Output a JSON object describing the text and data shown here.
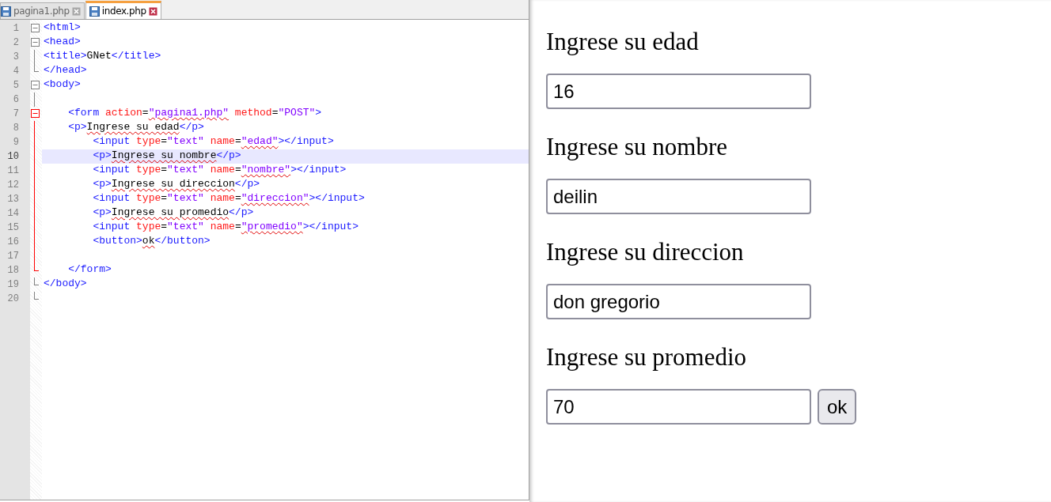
{
  "editor": {
    "tabs": [
      {
        "label": "pagina1.php",
        "selected": false
      },
      {
        "label": "index.php",
        "selected": true
      }
    ],
    "lines": [
      {
        "number": "1",
        "kind": "start",
        "color": "#808080",
        "current": false,
        "tokens": [
          {
            "t": "<html>",
            "kind": "tag"
          }
        ]
      },
      {
        "number": "2",
        "kind": "start",
        "color": "#808080",
        "current": false,
        "tokens": [
          {
            "t": "<head>",
            "kind": "tag"
          }
        ]
      },
      {
        "number": "3",
        "kind": "body",
        "color": "#808080",
        "current": false,
        "tokens": [
          {
            "t": "<title>",
            "kind": "tag"
          },
          {
            "t": "GNet",
            "kind": "text"
          },
          {
            "t": "</title>",
            "kind": "tag"
          }
        ]
      },
      {
        "number": "4",
        "kind": "end",
        "color": "#808080",
        "current": false,
        "tokens": [
          {
            "t": "</head>",
            "kind": "tag"
          }
        ]
      },
      {
        "number": "5",
        "kind": "start",
        "color": "#808080",
        "current": false,
        "tokens": [
          {
            "t": "<body>",
            "kind": "tag"
          }
        ]
      },
      {
        "number": "6",
        "kind": "body",
        "color": "#808080",
        "current": false
      },
      {
        "number": "7",
        "kind": "start",
        "color": "#ff0000",
        "current": false,
        "tokens": [
          {
            "t": "    <form ",
            "kind": "tag"
          },
          {
            "t": "action",
            "kind": "attr"
          },
          {
            "t": "=",
            "kind": "text"
          },
          {
            "t": "\"pagina1.php\"",
            "kind": "value",
            "flagged": true
          },
          {
            "t": " method",
            "kind": "attr"
          },
          {
            "t": "=",
            "kind": "text"
          },
          {
            "t": "\"POST\"",
            "kind": "value"
          },
          {
            "t": ">",
            "kind": "tag"
          }
        ]
      },
      {
        "number": "8",
        "kind": "body",
        "color": "#ff0000",
        "current": false,
        "tokens": [
          {
            "t": "    <p>",
            "kind": "tag"
          },
          {
            "t": "Ingrese su edad",
            "kind": "text",
            "flagged": true
          },
          {
            "t": "</p>",
            "kind": "tag"
          }
        ]
      },
      {
        "number": "9",
        "kind": "body",
        "color": "#ff0000",
        "current": false,
        "tokens": [
          {
            "t": "        <input ",
            "kind": "tag"
          },
          {
            "t": "type",
            "kind": "attr"
          },
          {
            "t": "=",
            "kind": "text"
          },
          {
            "t": "\"text\"",
            "kind": "value"
          },
          {
            "t": " name",
            "kind": "attr"
          },
          {
            "t": "=",
            "kind": "text"
          },
          {
            "t": "\"edad\"",
            "kind": "value",
            "flagged": true
          },
          {
            "t": "></input>",
            "kind": "tag"
          }
        ]
      },
      {
        "number": "10",
        "kind": "body",
        "color": "#ff0000",
        "current": true,
        "tokens": [
          {
            "t": "        <p>",
            "kind": "tag"
          },
          {
            "t": "Ingrese su nombre",
            "kind": "text",
            "flagged": true
          },
          {
            "t": "</p>",
            "kind": "tag"
          }
        ]
      },
      {
        "number": "11",
        "kind": "body",
        "color": "#ff0000",
        "current": false,
        "tokens": [
          {
            "t": "        <input ",
            "kind": "tag"
          },
          {
            "t": "type",
            "kind": "attr"
          },
          {
            "t": "=",
            "kind": "text"
          },
          {
            "t": "\"text\"",
            "kind": "value"
          },
          {
            "t": " name",
            "kind": "attr"
          },
          {
            "t": "=",
            "kind": "text"
          },
          {
            "t": "\"nombre\"",
            "kind": "value",
            "flagged": true
          },
          {
            "t": "></input>",
            "kind": "tag"
          }
        ]
      },
      {
        "number": "12",
        "kind": "body",
        "color": "#ff0000",
        "current": false,
        "tokens": [
          {
            "t": "        <p>",
            "kind": "tag"
          },
          {
            "t": "Ingrese su direccion",
            "kind": "text",
            "flagged": true
          },
          {
            "t": "</p>",
            "kind": "tag"
          }
        ]
      },
      {
        "number": "13",
        "kind": "body",
        "color": "#ff0000",
        "current": false,
        "tokens": [
          {
            "t": "        <input ",
            "kind": "tag"
          },
          {
            "t": "type",
            "kind": "attr"
          },
          {
            "t": "=",
            "kind": "text"
          },
          {
            "t": "\"text\"",
            "kind": "value"
          },
          {
            "t": " name",
            "kind": "attr"
          },
          {
            "t": "=",
            "kind": "text"
          },
          {
            "t": "\"direccion\"",
            "kind": "value",
            "flagged": true
          },
          {
            "t": "></input>",
            "kind": "tag"
          }
        ]
      },
      {
        "number": "14",
        "kind": "body",
        "color": "#ff0000",
        "current": false,
        "tokens": [
          {
            "t": "        <p>",
            "kind": "tag"
          },
          {
            "t": "Ingrese su promedio",
            "kind": "text",
            "flagged": true
          },
          {
            "t": "</p>",
            "kind": "tag"
          }
        ]
      },
      {
        "number": "15",
        "kind": "body",
        "color": "#ff0000",
        "current": false,
        "tokens": [
          {
            "t": "        <input ",
            "kind": "tag"
          },
          {
            "t": "type",
            "kind": "attr"
          },
          {
            "t": "=",
            "kind": "text"
          },
          {
            "t": "\"text\"",
            "kind": "value"
          },
          {
            "t": " name",
            "kind": "attr"
          },
          {
            "t": "=",
            "kind": "text"
          },
          {
            "t": "\"promedio\"",
            "kind": "value",
            "flagged": true
          },
          {
            "t": "></input>",
            "kind": "tag"
          }
        ]
      },
      {
        "number": "16",
        "kind": "body",
        "color": "#ff0000",
        "current": false,
        "tokens": [
          {
            "t": "        <button>",
            "kind": "tag"
          },
          {
            "t": "ok",
            "kind": "text",
            "flagged": true
          },
          {
            "t": "</button>",
            "kind": "tag"
          }
        ]
      },
      {
        "number": "17",
        "kind": "body",
        "color": "#ff0000",
        "current": false
      },
      {
        "number": "18",
        "kind": "end",
        "color": "#ff0000",
        "current": false,
        "tokens": [
          {
            "t": "    </form>",
            "kind": "tag"
          }
        ]
      },
      {
        "number": "19",
        "kind": "end",
        "color": "#808080",
        "current": false,
        "tokens": [
          {
            "t": "</body>",
            "kind": "tag"
          }
        ]
      },
      {
        "number": "20",
        "kind": "end",
        "color": "#808080",
        "current": false
      }
    ]
  },
  "preview": {
    "fields": [
      {
        "label": "Ingrese su edad",
        "value": "16"
      },
      {
        "label": "Ingrese su nombre",
        "value": "deilin"
      },
      {
        "label": "Ingrese su direccion",
        "value": "don gregorio"
      },
      {
        "label": "Ingrese su promedio",
        "value": "70"
      }
    ],
    "button": "ok"
  }
}
